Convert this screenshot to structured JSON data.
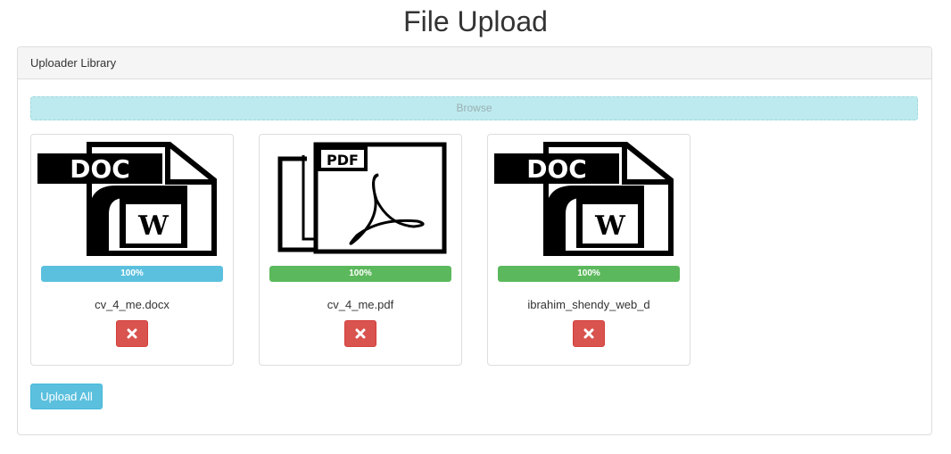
{
  "page": {
    "title": "File Upload"
  },
  "panel": {
    "heading": "Uploader Library"
  },
  "browse": {
    "label": "Browse"
  },
  "files": [
    {
      "name": "cv_4_me.docx",
      "icon": "doc-file-icon",
      "progress_text": "100%",
      "progress": 1.0,
      "progress_color": "#5bc0de"
    },
    {
      "name": "cv_4_me.pdf",
      "icon": "pdf-file-icon",
      "progress_text": "100%",
      "progress": 1.0,
      "progress_color": "#5cb85c"
    },
    {
      "name": "ibrahim_shendy_web_d",
      "icon": "doc-file-icon",
      "progress_text": "100%",
      "progress": 1.0,
      "progress_color": "#5cb85c"
    }
  ],
  "actions": {
    "upload_all_label": "Upload All"
  },
  "colors": {
    "info": "#5bc0de",
    "success": "#5cb85c",
    "danger": "#d9534f",
    "browse_bg": "#bdeaee"
  }
}
